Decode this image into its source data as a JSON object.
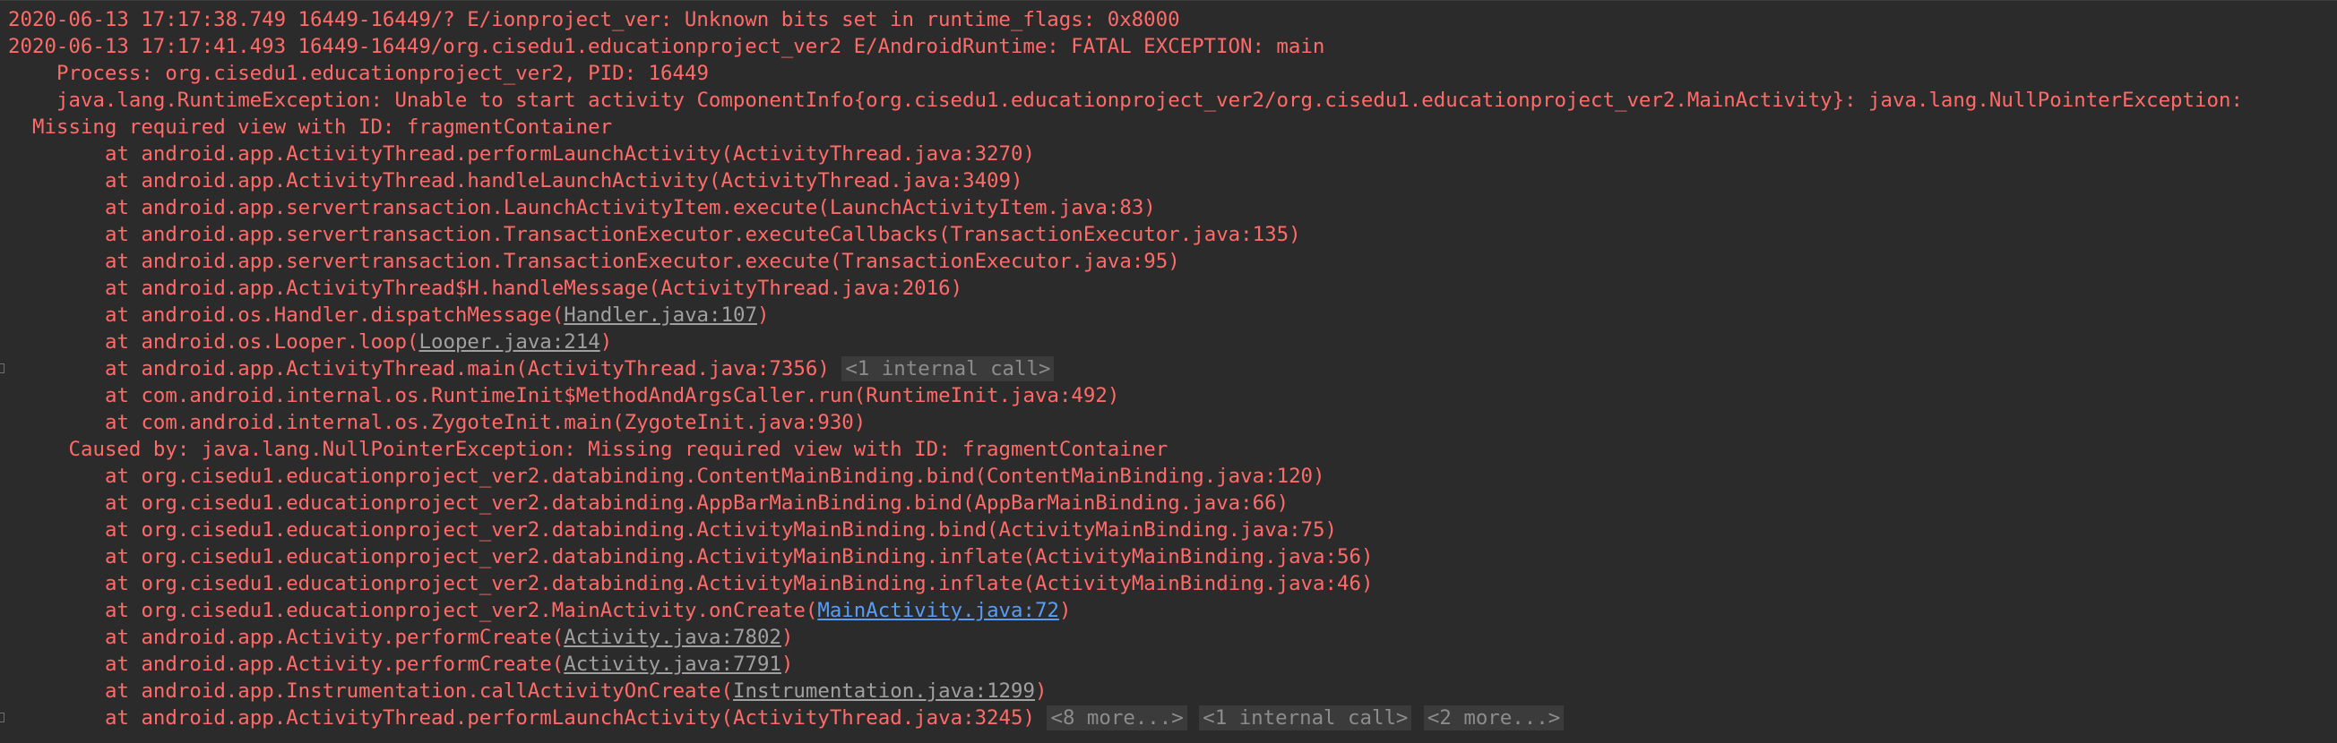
{
  "colors": {
    "background": "#2b2b2b",
    "error_text": "#ff6b68",
    "link_gray": "#a0a0a0",
    "link_blue": "#589df6",
    "fold_bg": "#3b3b3b",
    "fold_text": "#8c8c8c"
  },
  "lines": [
    {
      "indent": 0,
      "segs": [
        {
          "t": "text",
          "v": "2020-06-13 17:17:38.749 16449-16449/? E/ionproject_ver: Unknown bits set in runtime_flags: 0x8000"
        }
      ]
    },
    {
      "indent": 0,
      "segs": [
        {
          "t": "text",
          "v": "2020-06-13 17:17:41.493 16449-16449/org.cisedu1.educationproject_ver2 E/AndroidRuntime: FATAL EXCEPTION: main"
        }
      ]
    },
    {
      "indent": 4,
      "segs": [
        {
          "t": "text",
          "v": "Process: org.cisedu1.educationproject_ver2, PID: 16449"
        }
      ]
    },
    {
      "indent": 4,
      "segs": [
        {
          "t": "text",
          "v": "java.lang.RuntimeException: Unable to start activity ComponentInfo{org.cisedu1.educationproject_ver2/org.cisedu1.educationproject_ver2.MainActivity}: java.lang.NullPointerException:"
        }
      ]
    },
    {
      "indent": 2,
      "segs": [
        {
          "t": "text",
          "v": "Missing required view with ID: fragmentContainer"
        }
      ]
    },
    {
      "indent": 8,
      "segs": [
        {
          "t": "text",
          "v": "at android.app.ActivityThread.performLaunchActivity(ActivityThread.java:3270)"
        }
      ]
    },
    {
      "indent": 8,
      "segs": [
        {
          "t": "text",
          "v": "at android.app.ActivityThread.handleLaunchActivity(ActivityThread.java:3409)"
        }
      ]
    },
    {
      "indent": 8,
      "segs": [
        {
          "t": "text",
          "v": "at android.app.servertransaction.LaunchActivityItem.execute(LaunchActivityItem.java:83)"
        }
      ]
    },
    {
      "indent": 8,
      "segs": [
        {
          "t": "text",
          "v": "at android.app.servertransaction.TransactionExecutor.executeCallbacks(TransactionExecutor.java:135)"
        }
      ]
    },
    {
      "indent": 8,
      "segs": [
        {
          "t": "text",
          "v": "at android.app.servertransaction.TransactionExecutor.execute(TransactionExecutor.java:95)"
        }
      ]
    },
    {
      "indent": 8,
      "segs": [
        {
          "t": "text",
          "v": "at android.app.ActivityThread$H.handleMessage(ActivityThread.java:2016)"
        }
      ]
    },
    {
      "indent": 8,
      "segs": [
        {
          "t": "text",
          "v": "at android.os.Handler.dispatchMessage("
        },
        {
          "t": "link-gray",
          "v": "Handler.java:107"
        },
        {
          "t": "text",
          "v": ")"
        }
      ]
    },
    {
      "indent": 8,
      "segs": [
        {
          "t": "text",
          "v": "at android.os.Looper.loop("
        },
        {
          "t": "link-gray",
          "v": "Looper.java:214"
        },
        {
          "t": "text",
          "v": ")"
        }
      ]
    },
    {
      "indent": 8,
      "gutter": true,
      "segs": [
        {
          "t": "text",
          "v": "at android.app.ActivityThread.main(ActivityThread.java:7356) "
        },
        {
          "t": "fold",
          "v": "<1 internal call>"
        }
      ]
    },
    {
      "indent": 8,
      "segs": [
        {
          "t": "text",
          "v": "at com.android.internal.os.RuntimeInit$MethodAndArgsCaller.run(RuntimeInit.java:492)"
        }
      ]
    },
    {
      "indent": 8,
      "segs": [
        {
          "t": "text",
          "v": "at com.android.internal.os.ZygoteInit.main(ZygoteInit.java:930)"
        }
      ]
    },
    {
      "indent": 5,
      "segs": [
        {
          "t": "text",
          "v": "Caused by: java.lang.NullPointerException: Missing required view with ID: fragmentContainer"
        }
      ]
    },
    {
      "indent": 8,
      "segs": [
        {
          "t": "text",
          "v": "at org.cisedu1.educationproject_ver2.databinding.ContentMainBinding.bind(ContentMainBinding.java:120)"
        }
      ]
    },
    {
      "indent": 8,
      "segs": [
        {
          "t": "text",
          "v": "at org.cisedu1.educationproject_ver2.databinding.AppBarMainBinding.bind(AppBarMainBinding.java:66)"
        }
      ]
    },
    {
      "indent": 8,
      "segs": [
        {
          "t": "text",
          "v": "at org.cisedu1.educationproject_ver2.databinding.ActivityMainBinding.bind(ActivityMainBinding.java:75)"
        }
      ]
    },
    {
      "indent": 8,
      "segs": [
        {
          "t": "text",
          "v": "at org.cisedu1.educationproject_ver2.databinding.ActivityMainBinding.inflate(ActivityMainBinding.java:56)"
        }
      ]
    },
    {
      "indent": 8,
      "segs": [
        {
          "t": "text",
          "v": "at org.cisedu1.educationproject_ver2.databinding.ActivityMainBinding.inflate(ActivityMainBinding.java:46)"
        }
      ]
    },
    {
      "indent": 8,
      "segs": [
        {
          "t": "text",
          "v": "at org.cisedu1.educationproject_ver2.MainActivity.onCreate("
        },
        {
          "t": "link-blue",
          "v": "MainActivity.java:72"
        },
        {
          "t": "text",
          "v": ")"
        }
      ]
    },
    {
      "indent": 8,
      "segs": [
        {
          "t": "text",
          "v": "at android.app.Activity.performCreate("
        },
        {
          "t": "link-gray",
          "v": "Activity.java:7802"
        },
        {
          "t": "text",
          "v": ")"
        }
      ]
    },
    {
      "indent": 8,
      "segs": [
        {
          "t": "text",
          "v": "at android.app.Activity.performCreate("
        },
        {
          "t": "link-gray",
          "v": "Activity.java:7791"
        },
        {
          "t": "text",
          "v": ")"
        }
      ]
    },
    {
      "indent": 8,
      "segs": [
        {
          "t": "text",
          "v": "at android.app.Instrumentation.callActivityOnCreate("
        },
        {
          "t": "link-gray",
          "v": "Instrumentation.java:1299"
        },
        {
          "t": "text",
          "v": ")"
        }
      ]
    },
    {
      "indent": 8,
      "gutter": true,
      "segs": [
        {
          "t": "text",
          "v": "at android.app.ActivityThread.performLaunchActivity(ActivityThread.java:3245) "
        },
        {
          "t": "fold",
          "v": "<8 more...>"
        },
        {
          "t": "text",
          "v": " "
        },
        {
          "t": "fold",
          "v": "<1 internal call>"
        },
        {
          "t": "text",
          "v": " "
        },
        {
          "t": "fold",
          "v": "<2 more...>"
        }
      ]
    }
  ]
}
